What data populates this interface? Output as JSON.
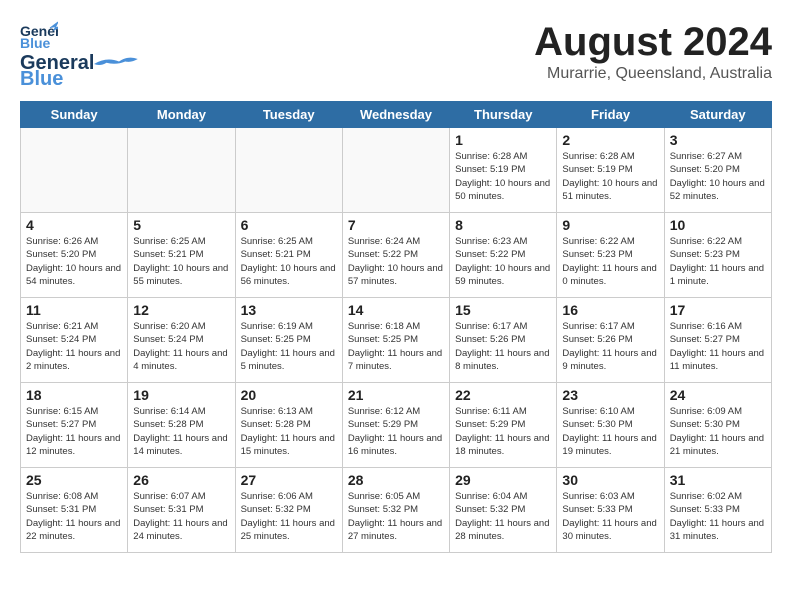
{
  "header": {
    "logo_line1": "General",
    "logo_line2": "Blue",
    "month": "August 2024",
    "location": "Murarrie, Queensland, Australia"
  },
  "weekdays": [
    "Sunday",
    "Monday",
    "Tuesday",
    "Wednesday",
    "Thursday",
    "Friday",
    "Saturday"
  ],
  "weeks": [
    [
      {
        "day": "",
        "info": ""
      },
      {
        "day": "",
        "info": ""
      },
      {
        "day": "",
        "info": ""
      },
      {
        "day": "",
        "info": ""
      },
      {
        "day": "1",
        "info": "Sunrise: 6:28 AM\nSunset: 5:19 PM\nDaylight: 10 hours\nand 50 minutes."
      },
      {
        "day": "2",
        "info": "Sunrise: 6:28 AM\nSunset: 5:19 PM\nDaylight: 10 hours\nand 51 minutes."
      },
      {
        "day": "3",
        "info": "Sunrise: 6:27 AM\nSunset: 5:20 PM\nDaylight: 10 hours\nand 52 minutes."
      }
    ],
    [
      {
        "day": "4",
        "info": "Sunrise: 6:26 AM\nSunset: 5:20 PM\nDaylight: 10 hours\nand 54 minutes."
      },
      {
        "day": "5",
        "info": "Sunrise: 6:25 AM\nSunset: 5:21 PM\nDaylight: 10 hours\nand 55 minutes."
      },
      {
        "day": "6",
        "info": "Sunrise: 6:25 AM\nSunset: 5:21 PM\nDaylight: 10 hours\nand 56 minutes."
      },
      {
        "day": "7",
        "info": "Sunrise: 6:24 AM\nSunset: 5:22 PM\nDaylight: 10 hours\nand 57 minutes."
      },
      {
        "day": "8",
        "info": "Sunrise: 6:23 AM\nSunset: 5:22 PM\nDaylight: 10 hours\nand 59 minutes."
      },
      {
        "day": "9",
        "info": "Sunrise: 6:22 AM\nSunset: 5:23 PM\nDaylight: 11 hours\nand 0 minutes."
      },
      {
        "day": "10",
        "info": "Sunrise: 6:22 AM\nSunset: 5:23 PM\nDaylight: 11 hours\nand 1 minute."
      }
    ],
    [
      {
        "day": "11",
        "info": "Sunrise: 6:21 AM\nSunset: 5:24 PM\nDaylight: 11 hours\nand 2 minutes."
      },
      {
        "day": "12",
        "info": "Sunrise: 6:20 AM\nSunset: 5:24 PM\nDaylight: 11 hours\nand 4 minutes."
      },
      {
        "day": "13",
        "info": "Sunrise: 6:19 AM\nSunset: 5:25 PM\nDaylight: 11 hours\nand 5 minutes."
      },
      {
        "day": "14",
        "info": "Sunrise: 6:18 AM\nSunset: 5:25 PM\nDaylight: 11 hours\nand 7 minutes."
      },
      {
        "day": "15",
        "info": "Sunrise: 6:17 AM\nSunset: 5:26 PM\nDaylight: 11 hours\nand 8 minutes."
      },
      {
        "day": "16",
        "info": "Sunrise: 6:17 AM\nSunset: 5:26 PM\nDaylight: 11 hours\nand 9 minutes."
      },
      {
        "day": "17",
        "info": "Sunrise: 6:16 AM\nSunset: 5:27 PM\nDaylight: 11 hours\nand 11 minutes."
      }
    ],
    [
      {
        "day": "18",
        "info": "Sunrise: 6:15 AM\nSunset: 5:27 PM\nDaylight: 11 hours\nand 12 minutes."
      },
      {
        "day": "19",
        "info": "Sunrise: 6:14 AM\nSunset: 5:28 PM\nDaylight: 11 hours\nand 14 minutes."
      },
      {
        "day": "20",
        "info": "Sunrise: 6:13 AM\nSunset: 5:28 PM\nDaylight: 11 hours\nand 15 minutes."
      },
      {
        "day": "21",
        "info": "Sunrise: 6:12 AM\nSunset: 5:29 PM\nDaylight: 11 hours\nand 16 minutes."
      },
      {
        "day": "22",
        "info": "Sunrise: 6:11 AM\nSunset: 5:29 PM\nDaylight: 11 hours\nand 18 minutes."
      },
      {
        "day": "23",
        "info": "Sunrise: 6:10 AM\nSunset: 5:30 PM\nDaylight: 11 hours\nand 19 minutes."
      },
      {
        "day": "24",
        "info": "Sunrise: 6:09 AM\nSunset: 5:30 PM\nDaylight: 11 hours\nand 21 minutes."
      }
    ],
    [
      {
        "day": "25",
        "info": "Sunrise: 6:08 AM\nSunset: 5:31 PM\nDaylight: 11 hours\nand 22 minutes."
      },
      {
        "day": "26",
        "info": "Sunrise: 6:07 AM\nSunset: 5:31 PM\nDaylight: 11 hours\nand 24 minutes."
      },
      {
        "day": "27",
        "info": "Sunrise: 6:06 AM\nSunset: 5:32 PM\nDaylight: 11 hours\nand 25 minutes."
      },
      {
        "day": "28",
        "info": "Sunrise: 6:05 AM\nSunset: 5:32 PM\nDaylight: 11 hours\nand 27 minutes."
      },
      {
        "day": "29",
        "info": "Sunrise: 6:04 AM\nSunset: 5:32 PM\nDaylight: 11 hours\nand 28 minutes."
      },
      {
        "day": "30",
        "info": "Sunrise: 6:03 AM\nSunset: 5:33 PM\nDaylight: 11 hours\nand 30 minutes."
      },
      {
        "day": "31",
        "info": "Sunrise: 6:02 AM\nSunset: 5:33 PM\nDaylight: 11 hours\nand 31 minutes."
      }
    ]
  ]
}
